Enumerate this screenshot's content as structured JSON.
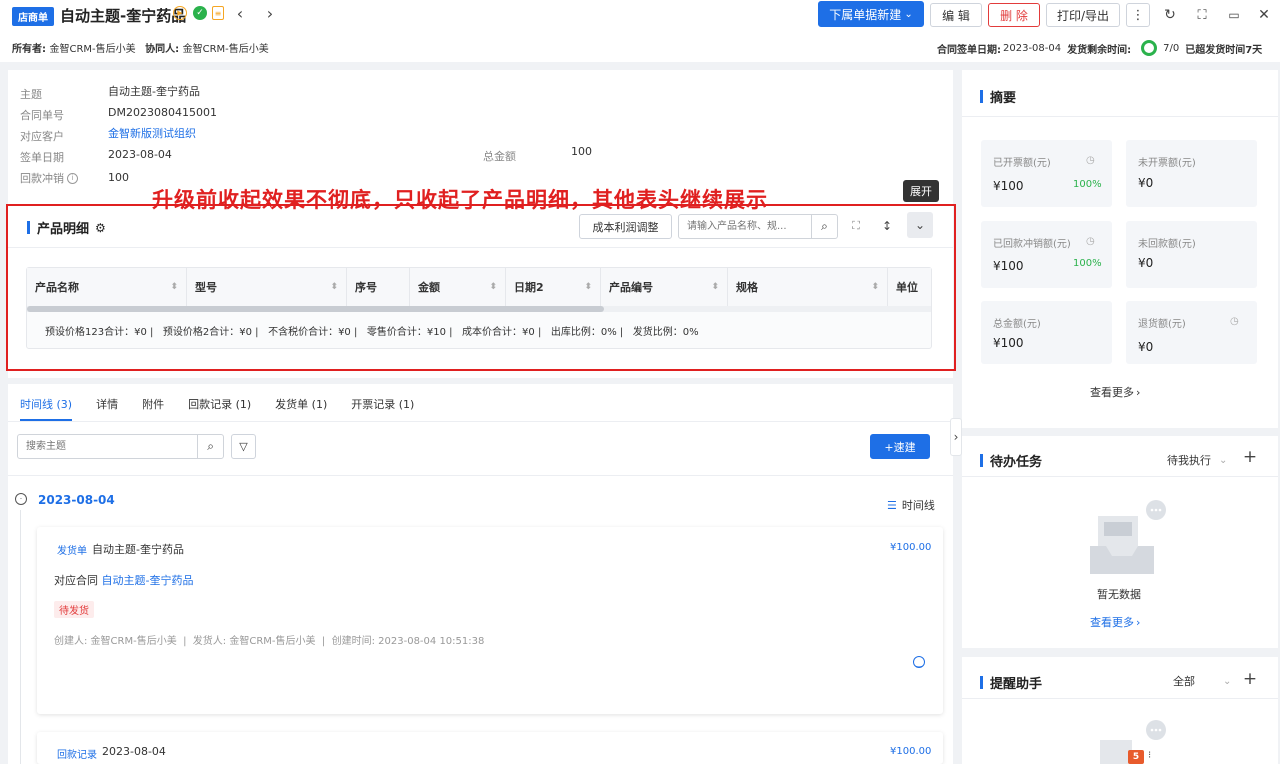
{
  "header": {
    "badge": "店商单",
    "title": "自动主题-奎宁药品",
    "new_button": "下属单据新建",
    "edit_button": "编 辑",
    "delete_button": "删 除",
    "print_button": "打印/导出",
    "owner_label": "所有者:",
    "owner_value": "金智CRM-售后小美",
    "collab_label": "协同人:",
    "collab_value": "金智CRM-售后小美",
    "sign_date_label": "合同签单日期:",
    "sign_date_value": "2023-08-04",
    "ship_remain_label": "发货剩余时间:",
    "ship_remain_value": "7/0",
    "overdue_text": "已超发货时间7天"
  },
  "info": {
    "rows": [
      {
        "label": "主题",
        "value": "自动主题-奎宁药品"
      },
      {
        "label": "合同单号",
        "value": "DM2023080415001"
      },
      {
        "label": "对应客户",
        "value": "金智新版测试组织"
      },
      {
        "label": "签单日期",
        "value": "2023-08-04"
      },
      {
        "label": "回款冲销",
        "value": "100"
      }
    ],
    "total_label": "总金额",
    "total_value": "100"
  },
  "annotation": "升级前收起效果不彻底，只收起了产品明细，其他表头继续展示",
  "tooltip": "展开",
  "product": {
    "title": "产品明细",
    "cost_button": "成本利润调整",
    "search_placeholder": "请输入产品名称、规...",
    "columns": [
      "产品名称",
      "型号",
      "序号",
      "金额",
      "日期2",
      "产品编号",
      "规格",
      "单位"
    ],
    "summary": "预设价格123合计：¥0 |   预设价格2合计：¥0 |   不含税价合计：¥0 |   零售价合计：¥10 |   成本价合计：¥0 |   出库比例：0% |   发货比例：0%"
  },
  "tabs": [
    {
      "label": "时间线 (3)"
    },
    {
      "label": "详情"
    },
    {
      "label": "附件"
    },
    {
      "label": "回款记录 (1)"
    },
    {
      "label": "发货单 (1)"
    },
    {
      "label": "开票记录 (1)"
    }
  ],
  "timeline": {
    "search_placeholder": "搜索主题",
    "quick_button": "+速建",
    "date": "2023-08-04",
    "view_label": "时间线",
    "item1": {
      "type": "发货单",
      "title": "自动主题-奎宁药品",
      "amount": "¥100.00",
      "contract_label": "对应合同",
      "contract_link": "自动主题-奎宁药品",
      "status": "待发货",
      "meta": "创建人: 金智CRM-售后小美  |  发货人: 金智CRM-售后小美  |  创建时间: 2023-08-04 10:51:38"
    },
    "item2": {
      "type": "回款记录",
      "title": "2023-08-04",
      "amount": "¥100.00"
    }
  },
  "summary": {
    "title": "摘要",
    "cards": [
      {
        "label": "已开票额(元)",
        "value": "¥100",
        "pct": "100%"
      },
      {
        "label": "未开票额(元)",
        "value": "¥0",
        "pct": ""
      },
      {
        "label": "已回款冲销额(元)",
        "value": "¥100",
        "pct": "100%"
      },
      {
        "label": "未回款额(元)",
        "value": "¥0",
        "pct": ""
      },
      {
        "label": "总金额(元)",
        "value": "¥100",
        "pct": ""
      },
      {
        "label": "退货额(元)",
        "value": "¥0",
        "pct": ""
      }
    ],
    "more": "查看更多"
  },
  "todo": {
    "title": "待办任务",
    "filter": "待我执行",
    "empty": "暂无数据",
    "more": "查看更多"
  },
  "reminder": {
    "title": "提醒助手",
    "filter": "全部"
  },
  "colors": {
    "primary": "#1e6fe6",
    "danger": "#e23b3b",
    "success": "#2bb24c",
    "annotation": "#e02020"
  }
}
